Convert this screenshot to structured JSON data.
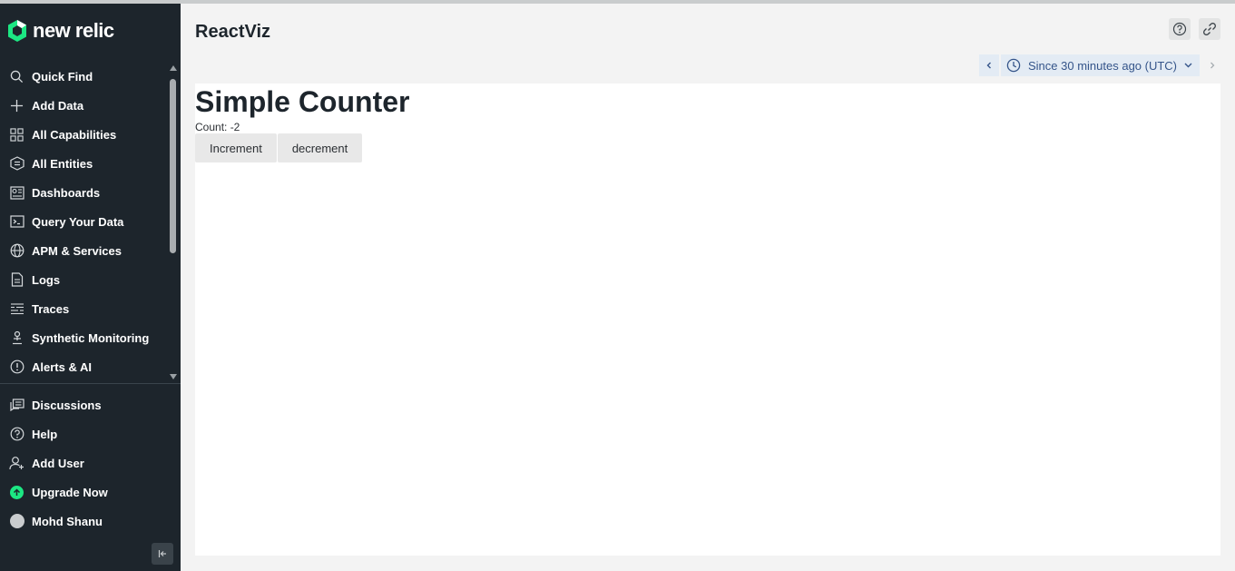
{
  "brand": {
    "name": "new relic",
    "accent": "#1ce783"
  },
  "sidebar": {
    "items": [
      {
        "label": "Quick Find",
        "icon": "search-icon"
      },
      {
        "label": "Add Data",
        "icon": "plus-icon"
      },
      {
        "label": "All Capabilities",
        "icon": "grid-icon"
      },
      {
        "label": "All Entities",
        "icon": "entities-icon"
      },
      {
        "label": "Dashboards",
        "icon": "dashboard-icon"
      },
      {
        "label": "Query Your Data",
        "icon": "terminal-icon"
      },
      {
        "label": "APM & Services",
        "icon": "globe-icon"
      },
      {
        "label": "Logs",
        "icon": "document-icon"
      },
      {
        "label": "Traces",
        "icon": "traces-icon"
      },
      {
        "label": "Synthetic Monitoring",
        "icon": "synthetic-icon"
      },
      {
        "label": "Alerts & AI",
        "icon": "alert-icon"
      }
    ],
    "bottom_items": [
      {
        "label": "Discussions",
        "icon": "discussions-icon"
      },
      {
        "label": "Help",
        "icon": "help-icon"
      },
      {
        "label": "Add User",
        "icon": "add-user-icon"
      },
      {
        "label": "Upgrade Now",
        "icon": "upgrade-icon"
      },
      {
        "label": "Mohd Shanu",
        "icon": "avatar"
      }
    ]
  },
  "header": {
    "title": "ReactViz",
    "time_picker": {
      "label": "Since 30 minutes ago (UTC)"
    }
  },
  "app": {
    "title": "Simple Counter",
    "count_text": "Count: -2",
    "increment_label": "Increment",
    "decrement_label": "decrement"
  }
}
